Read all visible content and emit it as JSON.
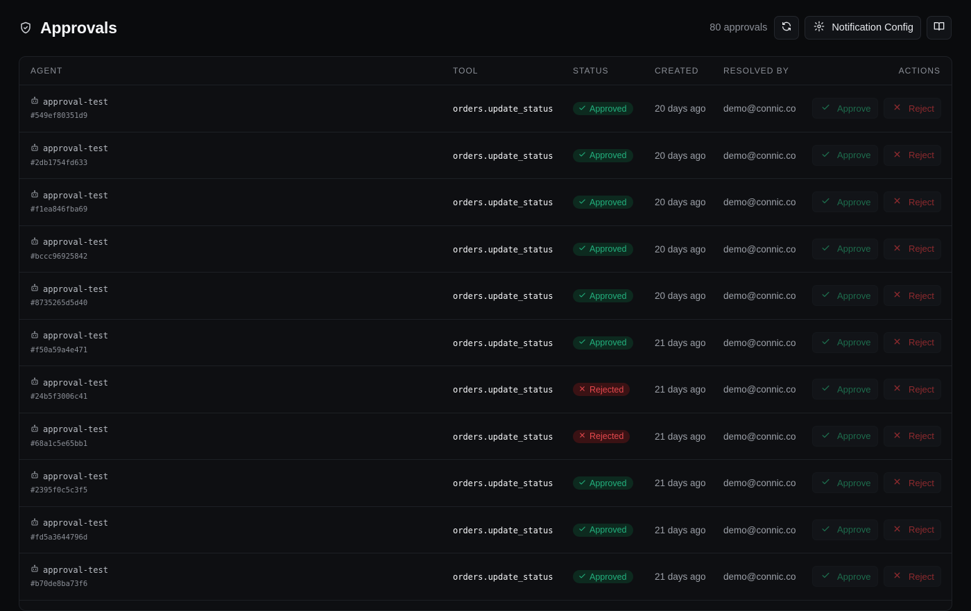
{
  "header": {
    "title": "Approvals",
    "count_label": "80 approvals",
    "notification_config_label": "Notification Config"
  },
  "table": {
    "columns": [
      "Agent",
      "Tool",
      "Status",
      "Created",
      "Resolved by",
      "Actions"
    ],
    "action_labels": {
      "approve": "Approve",
      "reject": "Reject"
    },
    "rows": [
      {
        "agent": "approval-test",
        "id": "#549ef80351d9",
        "tool": "orders.update_status",
        "status": "Approved",
        "created": "20 days ago",
        "resolved_by": "demo@connic.co"
      },
      {
        "agent": "approval-test",
        "id": "#2db1754fd633",
        "tool": "orders.update_status",
        "status": "Approved",
        "created": "20 days ago",
        "resolved_by": "demo@connic.co"
      },
      {
        "agent": "approval-test",
        "id": "#f1ea846fba69",
        "tool": "orders.update_status",
        "status": "Approved",
        "created": "20 days ago",
        "resolved_by": "demo@connic.co"
      },
      {
        "agent": "approval-test",
        "id": "#bccc96925842",
        "tool": "orders.update_status",
        "status": "Approved",
        "created": "20 days ago",
        "resolved_by": "demo@connic.co"
      },
      {
        "agent": "approval-test",
        "id": "#8735265d5d40",
        "tool": "orders.update_status",
        "status": "Approved",
        "created": "20 days ago",
        "resolved_by": "demo@connic.co"
      },
      {
        "agent": "approval-test",
        "id": "#f50a59a4e471",
        "tool": "orders.update_status",
        "status": "Approved",
        "created": "21 days ago",
        "resolved_by": "demo@connic.co"
      },
      {
        "agent": "approval-test",
        "id": "#24b5f3006c41",
        "tool": "orders.update_status",
        "status": "Rejected",
        "created": "21 days ago",
        "resolved_by": "demo@connic.co"
      },
      {
        "agent": "approval-test",
        "id": "#68a1c5e65bb1",
        "tool": "orders.update_status",
        "status": "Rejected",
        "created": "21 days ago",
        "resolved_by": "demo@connic.co"
      },
      {
        "agent": "approval-test",
        "id": "#2395f0c5c3f5",
        "tool": "orders.update_status",
        "status": "Approved",
        "created": "21 days ago",
        "resolved_by": "demo@connic.co"
      },
      {
        "agent": "approval-test",
        "id": "#fd5a3644796d",
        "tool": "orders.update_status",
        "status": "Approved",
        "created": "21 days ago",
        "resolved_by": "demo@connic.co"
      },
      {
        "agent": "approval-test",
        "id": "#b70de8ba73f6",
        "tool": "orders.update_status",
        "status": "Approved",
        "created": "21 days ago",
        "resolved_by": "demo@connic.co"
      }
    ]
  },
  "colors": {
    "background": "#0a0b0d",
    "approved": "#22b07d",
    "rejected": "#e5484d"
  },
  "icons": {
    "title": "shield-icon",
    "refresh": "refresh-icon",
    "config": "gear-icon",
    "docs": "book-icon",
    "agent": "bot-icon",
    "approve": "check-icon",
    "reject": "x-icon"
  }
}
